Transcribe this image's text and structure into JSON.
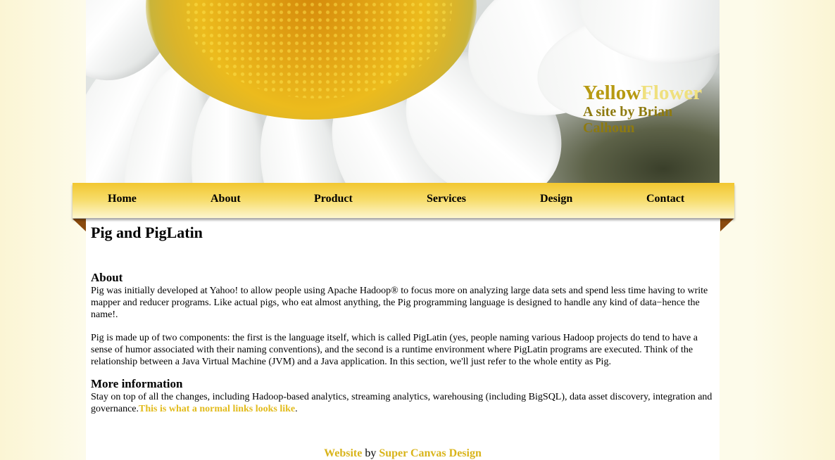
{
  "header": {
    "title_part1": "Yellow",
    "title_part2": "Flower",
    "subtitle": "A site by Brian Calhoun"
  },
  "nav": {
    "items": [
      {
        "label": "Home"
      },
      {
        "label": "About"
      },
      {
        "label": "Product"
      },
      {
        "label": "Services"
      },
      {
        "label": "Design"
      },
      {
        "label": "Contact"
      }
    ]
  },
  "main": {
    "page_title": "Pig and PigLatin",
    "about_heading": "About",
    "about_p1": "Pig was initially developed at Yahoo! to allow people using Apache Hadoop® to focus more on analyzing large data sets and spend less time having to write mapper and reducer programs. Like actual pigs, who eat almost anything, the Pig programming language is designed to handle any kind of data−hence the name!.",
    "about_p2": "Pig is made up of two components: the first is the language itself, which is called PigLatin (yes, people naming various Hadoop projects do tend to have a sense of humor associated with their naming conventions), and the second is a runtime environment where PigLatin programs are executed. Think of the relationship between a Java Virtual Machine (JVM) and a Java application. In this section, we'll just refer to the whole entity as Pig.",
    "more_heading": "More information",
    "more_text": "Stay on top of all the changes, including Hadoop-based analytics, streaming analytics, warehousing (including BigSQL), data asset discovery, integration and governance.",
    "more_link": "This is what a normal links looks like",
    "more_after": "."
  },
  "footer": {
    "link1": "Website",
    "by": " by ",
    "link2": "Super Canvas Design"
  },
  "colors": {
    "accent_gold": "#e2bb1c",
    "nav_gold": "#f2c730",
    "fold_brown": "#8a4a0e"
  }
}
